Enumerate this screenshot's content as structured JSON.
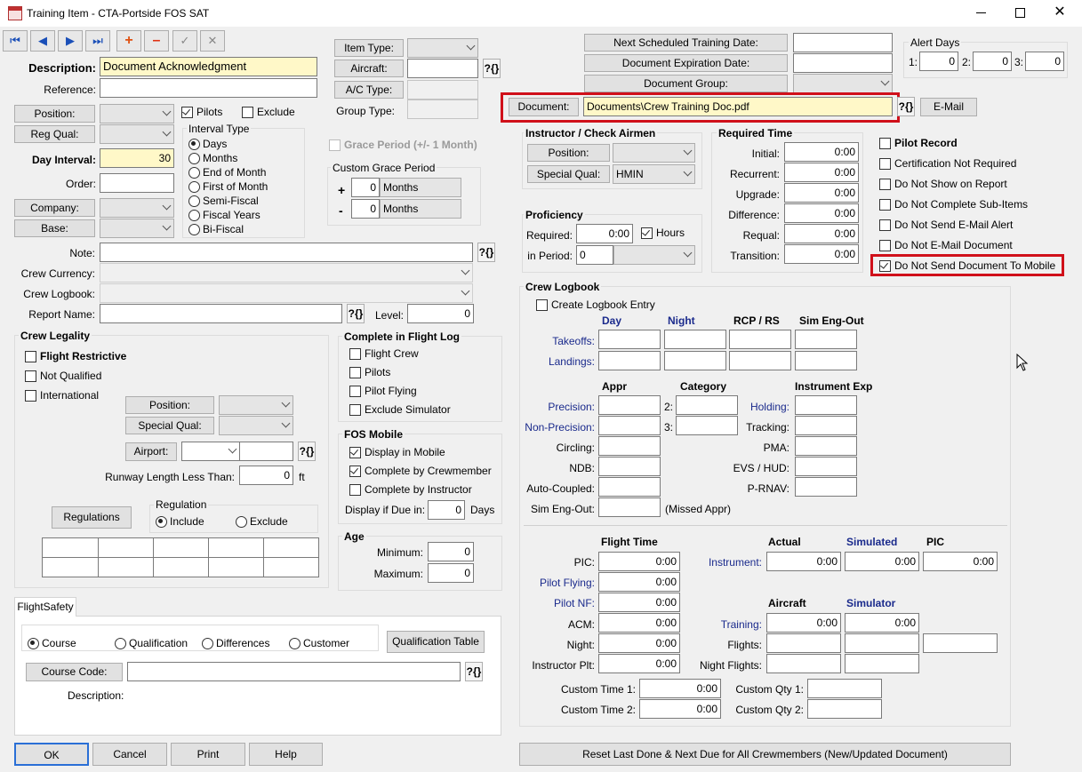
{
  "window": {
    "title": "Training Item - CTA-Portside FOS SAT"
  },
  "toolbar": {
    "first": "⏮",
    "prev": "◀",
    "next": "▶",
    "last": "⏭",
    "add": "+",
    "remove": "–",
    "save": "✓",
    "cancel": "✕"
  },
  "main": {
    "description_label": "Description:",
    "description_value": "Document Acknowledgment",
    "reference_label": "Reference:",
    "reference_value": "",
    "position_btn": "Position:",
    "pilots_cb": "Pilots",
    "exclude_cb": "Exclude",
    "regqual_btn": "Reg Qual:",
    "interval_type_title": "Interval Type",
    "interval_options": [
      "Days",
      "Months",
      "End of Month",
      "First of Month",
      "Semi-Fiscal",
      "Fiscal Years",
      "Bi-Fiscal"
    ],
    "day_interval_label": "Day Interval:",
    "day_interval_value": "30",
    "order_label": "Order:",
    "company_btn": "Company:",
    "base_btn": "Base:",
    "item_type_btn": "Item Type:",
    "aircraft_btn": "Aircraft:",
    "actype_btn": "A/C Type:",
    "group_type_label": "Group Type:",
    "grace_period": "Grace Period (+/- 1 Month)",
    "custom_grace_title": "Custom Grace Period",
    "plus": "+",
    "minus": "-",
    "grace_plus_value": "0",
    "grace_minus_value": "0",
    "grace_unit": "Months",
    "note_label": "Note:",
    "crew_currency_label": "Crew Currency:",
    "crew_logbook_label": "Crew Logbook:",
    "report_name_label": "Report Name:",
    "level_label": "Level:",
    "level_value": "0",
    "qmark": "?{}"
  },
  "top_right": {
    "next_sched_btn": "Next Scheduled Training Date:",
    "doc_exp_btn": "Document Expiration Date:",
    "doc_group_btn": "Document Group:",
    "alert_days_title": "Alert Days",
    "alert1_label": "1:",
    "alert1_value": "0",
    "alert2_label": "2:",
    "alert2_value": "0",
    "alert3_label": "3:",
    "alert3_value": "0",
    "document_btn": "Document:",
    "document_value": "Documents\\Crew Training Doc.pdf",
    "email_btn": "E-Mail"
  },
  "instructor": {
    "title": "Instructor / Check Airmen",
    "position_btn": "Position:",
    "special_qual_btn": "Special Qual:",
    "special_qual_value": "HMIN"
  },
  "required_time": {
    "title": "Required Time",
    "labels": [
      "Initial:",
      "Recurrent:",
      "Upgrade:",
      "Difference:",
      "Requal:",
      "Transition:"
    ],
    "values": [
      "0:00",
      "0:00",
      "0:00",
      "0:00",
      "0:00",
      "0:00"
    ]
  },
  "proficiency": {
    "title": "Proficiency",
    "required_label": "Required:",
    "required_value": "0:00",
    "hours_cb": "Hours",
    "period_label": "in Period:",
    "period_value": "0"
  },
  "flags": {
    "pilot_record": "Pilot Record",
    "cert_not_required": "Certification Not Required",
    "not_show_report": "Do Not Show on Report",
    "not_complete_sub": "Do Not Complete Sub-Items",
    "not_send_email": "Do Not Send E-Mail Alert",
    "not_email_doc": "Do Not E-Mail Document",
    "not_send_mobile": "Do Not Send Document To Mobile"
  },
  "crew_legality": {
    "title": "Crew Legality",
    "flight_restrictive": "Flight Restrictive",
    "not_qualified": "Not Qualified",
    "international": "International",
    "position_btn": "Position:",
    "special_qual_btn": "Special Qual:",
    "airport_btn": "Airport:",
    "runway_label": "Runway Length Less Than:",
    "runway_value": "0",
    "runway_unit": "ft",
    "regulations_btn": "Regulations",
    "regulation_title": "Regulation",
    "include": "Include",
    "exclude": "Exclude"
  },
  "complete_flight_log": {
    "title": "Complete in Flight Log",
    "items": [
      "Flight Crew",
      "Pilots",
      "Pilot Flying",
      "Exclude Simulator"
    ]
  },
  "fos_mobile": {
    "title": "FOS Mobile",
    "display_mobile": "Display in Mobile",
    "complete_crew": "Complete by Crewmember",
    "complete_instr": "Complete by Instructor",
    "display_due_label": "Display if Due in:",
    "display_due_value": "0",
    "days": "Days"
  },
  "age": {
    "title": "Age",
    "min_label": "Minimum:",
    "min_value": "0",
    "max_label": "Maximum:",
    "max_value": "0"
  },
  "flightsafety": {
    "tab": "FlightSafety",
    "course": "Course",
    "qualification": "Qualification",
    "differences": "Differences",
    "customer": "Customer",
    "qual_table_btn": "Qualification Table",
    "course_code_btn": "Course Code:",
    "description_label": "Description:"
  },
  "crew_logbook": {
    "title": "Crew Logbook",
    "create_entry": "Create Logbook Entry",
    "headers": {
      "day": "Day",
      "night": "Night",
      "rcp": "RCP / RS",
      "sim": "Sim Eng-Out"
    },
    "takeoffs": "Takeoffs:",
    "landings": "Landings:",
    "appr": "Appr",
    "category": "Category",
    "instrument_exp": "Instrument Exp",
    "appr_labels": [
      "Precision:",
      "Non-Precision:",
      "Circling:",
      "NDB:",
      "Auto-Coupled:",
      "Sim Eng-Out:"
    ],
    "missed": "(Missed Appr)",
    "cat2": "2:",
    "cat3": "3:",
    "inst_labels": [
      "Holding:",
      "Tracking:",
      "PMA:",
      "EVS / HUD:",
      "P-RNAV:"
    ],
    "flight_time": "Flight Time",
    "ft_labels": [
      "PIC:",
      "Pilot Flying:",
      "Pilot NF:",
      "ACM:",
      "Night:",
      "Instructor Plt:"
    ],
    "ft_values": [
      "0:00",
      "0:00",
      "0:00",
      "0:00",
      "0:00",
      "0:00"
    ],
    "actual": "Actual",
    "simulated": "Simulated",
    "pic": "PIC",
    "instrument": "Instrument:",
    "inst_actual": "0:00",
    "inst_sim": "0:00",
    "inst_pic": "0:00",
    "aircraft": "Aircraft",
    "simulator": "Simulator",
    "training": "Training:",
    "train_ac": "0:00",
    "train_sim": "0:00",
    "flights": "Flights:",
    "night_flights": "Night Flights:",
    "custom_time1": "Custom Time 1:",
    "custom_time1_value": "0:00",
    "custom_time2": "Custom Time 2:",
    "custom_time2_value": "0:00",
    "custom_qty1": "Custom Qty 1:",
    "custom_qty2": "Custom Qty 2:"
  },
  "bottom": {
    "ok": "OK",
    "cancel": "Cancel",
    "print": "Print",
    "help": "Help",
    "reset": "Reset Last Done & Next Due for All Crewmembers (New/Updated Document)"
  }
}
